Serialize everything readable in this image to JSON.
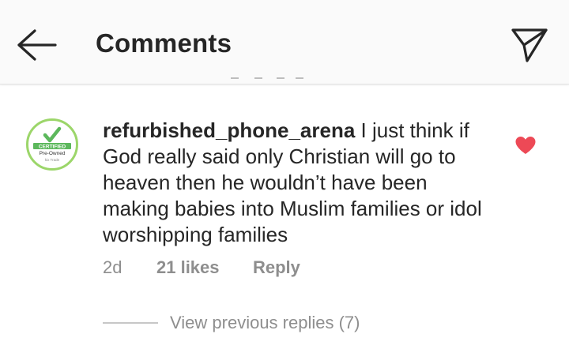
{
  "header": {
    "title": "Comments",
    "back_icon": "arrow-left-icon",
    "send_icon": "paper-plane-icon"
  },
  "comment": {
    "avatar": {
      "icon": "certified-badge-icon",
      "line1": "CERTIFIED",
      "line2": "Pre-Owned",
      "brand": "kix Trade"
    },
    "username": "refurbished_phone_arena",
    "text": "I just think if God really said only Christian will go to heaven then he wouldn’t have been making babies into Muslim families or idol worshipping families",
    "time": "2d",
    "likes": "21 likes",
    "reply_label": "Reply",
    "liked": true
  },
  "replies": {
    "view_label": "View previous replies (7)"
  },
  "colors": {
    "heart": "#ed4956",
    "meta_text": "#8e8e8e",
    "avatar_ring": "#9cd66a"
  }
}
